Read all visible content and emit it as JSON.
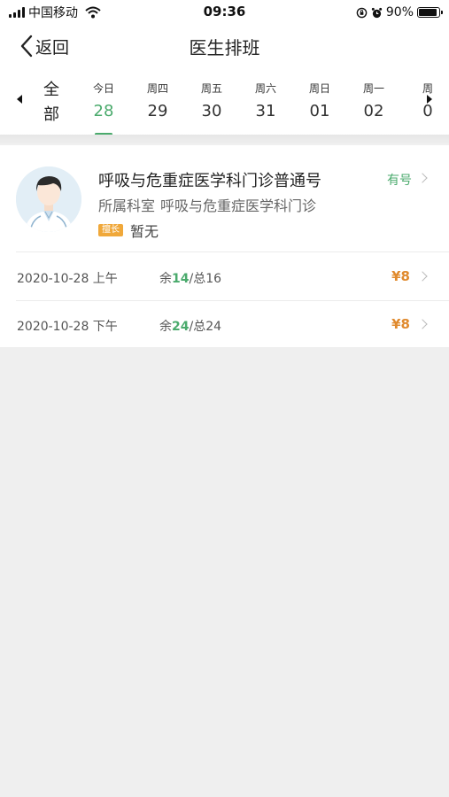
{
  "status_bar": {
    "carrier": "中国移动",
    "time": "09:36",
    "battery": "90%",
    "battery_level": 0.9
  },
  "nav": {
    "back_label": "返回",
    "title": "医生排班"
  },
  "date_strip": {
    "all_label_1": "全",
    "all_label_2": "部",
    "days": [
      {
        "week": "今日",
        "day": "28",
        "active": true
      },
      {
        "week": "周四",
        "day": "29",
        "active": false
      },
      {
        "week": "周五",
        "day": "30",
        "active": false
      },
      {
        "week": "周六",
        "day": "31",
        "active": false
      },
      {
        "week": "周日",
        "day": "01",
        "active": false
      },
      {
        "week": "周一",
        "day": "02",
        "active": false
      },
      {
        "week": "周",
        "day": "0",
        "active": false
      }
    ]
  },
  "doctor": {
    "name": "呼吸与危重症医学科门诊普通号",
    "dept_label": "所属科室",
    "dept_value": "呼吸与危重症医学科门诊",
    "specialty_tag": "擅长",
    "specialty_value": "暂无",
    "availability": "有号"
  },
  "slots": [
    {
      "date": "2020-10-28 上午",
      "rem_prefix": "余",
      "remaining": "14",
      "total_prefix": "/总",
      "total": "16",
      "price": "¥8"
    },
    {
      "date": "2020-10-28 下午",
      "rem_prefix": "余",
      "remaining": "24",
      "total_prefix": "/总",
      "total": "24",
      "price": "¥8"
    }
  ],
  "colors": {
    "accent_green": "#4aaa6c",
    "price_orange": "#e08a2e",
    "tag_orange": "#f0a83a"
  }
}
